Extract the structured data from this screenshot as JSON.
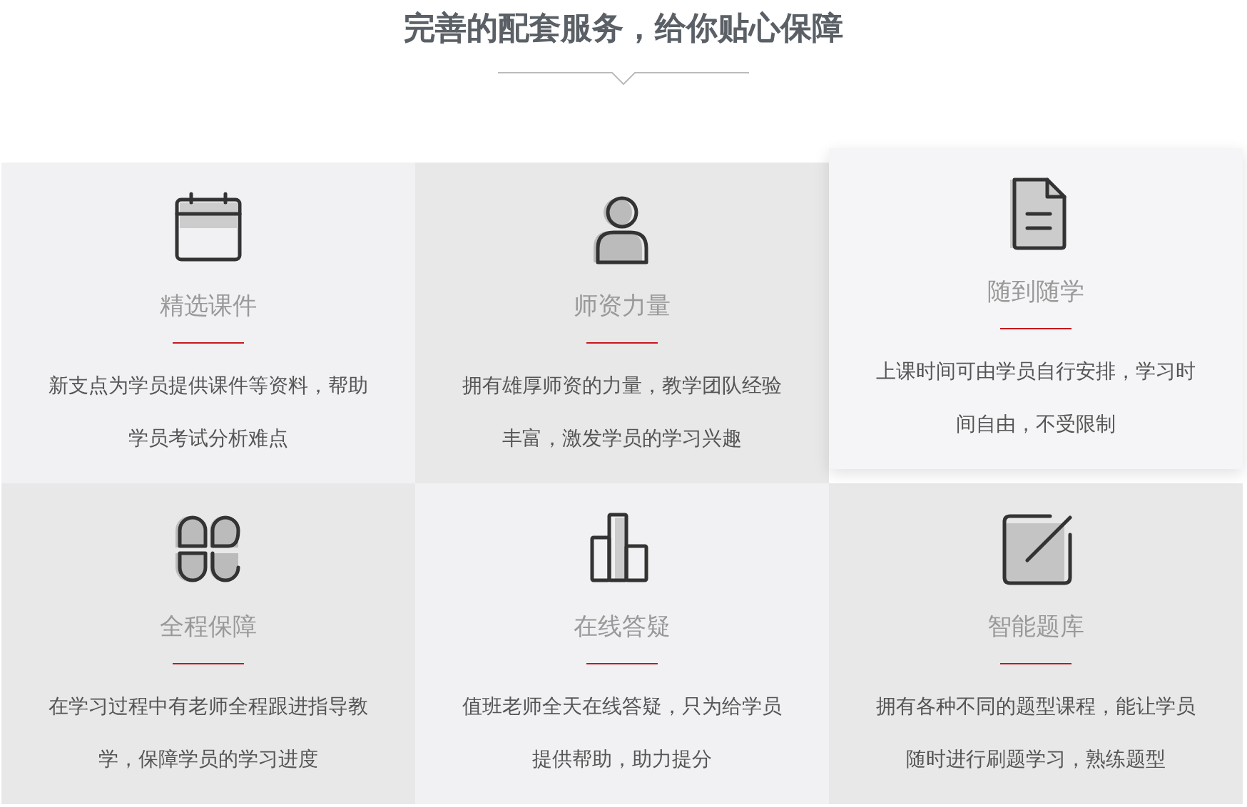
{
  "title": "完善的配套服务，给你贴心保障",
  "cards": [
    {
      "title": "精选课件",
      "text": "新支点为学员提供课件等资料，帮助学员考试分析难点",
      "raised": false
    },
    {
      "title": "师资力量",
      "text": "拥有雄厚师资的力量，教学团队经验丰富，激发学员的学习兴趣",
      "raised": false
    },
    {
      "title": "随到随学",
      "text": "上课时间可由学员自行安排，学习时间自由，不受限制",
      "raised": true
    },
    {
      "title": "全程保障",
      "text": "在学习过程中有老师全程跟进指导教学，保障学员的学习进度",
      "raised": false
    },
    {
      "title": "在线答疑",
      "text": "值班老师全天在线答疑，只为给学员提供帮助，助力提分",
      "raised": false
    },
    {
      "title": "智能题库",
      "text": "拥有各种不同的题型课程，能让学员随时进行刷题学习，熟练题型",
      "raised": false
    }
  ]
}
